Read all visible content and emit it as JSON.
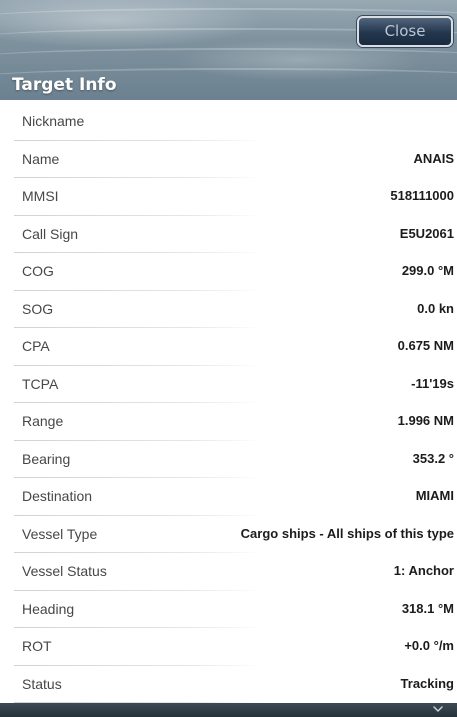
{
  "header": {
    "title": "Target Info",
    "close_label": "Close"
  },
  "rows": [
    {
      "label": "Nickname",
      "value": ""
    },
    {
      "label": "Name",
      "value": "ANAIS"
    },
    {
      "label": "MMSI",
      "value": "518111000"
    },
    {
      "label": "Call Sign",
      "value": "E5U2061"
    },
    {
      "label": "COG",
      "value": "299.0 °M"
    },
    {
      "label": "SOG",
      "value": "0.0 kn"
    },
    {
      "label": "CPA",
      "value": "0.675 NM"
    },
    {
      "label": "TCPA",
      "value": "-11'19s"
    },
    {
      "label": "Range",
      "value": "1.996 NM"
    },
    {
      "label": "Bearing",
      "value": "353.2 °"
    },
    {
      "label": "Destination",
      "value": "MIAMI"
    },
    {
      "label": "Vessel Type",
      "value": "Cargo ships - All ships of this type"
    },
    {
      "label": "Vessel Status",
      "value": "1: Anchor"
    },
    {
      "label": "Heading",
      "value": "318.1 °M"
    },
    {
      "label": "ROT",
      "value": "+0.0 °/m"
    },
    {
      "label": "Status",
      "value": "Tracking"
    }
  ],
  "icons": {
    "scroll_down": "chevron-down-icon"
  },
  "colors": {
    "header_blue_gray": "#7e929e",
    "close_button_dark_blue": "#24364d",
    "row_label": "#474747",
    "row_value": "#1c1c1c"
  }
}
